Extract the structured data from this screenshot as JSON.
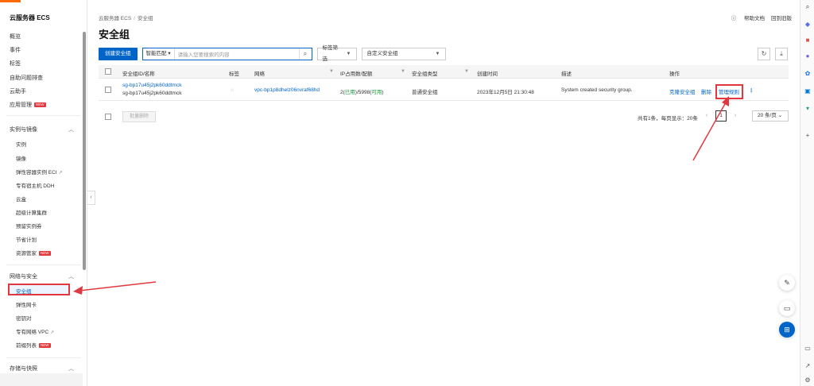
{
  "sidebar": {
    "brand": "云服务器 ECS",
    "top_items": [
      "概览",
      "事件",
      "标签",
      "自助问题排查",
      "云助手",
      "应用管理"
    ],
    "new_badge": "NEW",
    "group1": {
      "title": "实例与镜像",
      "items": [
        "实例",
        "镜像",
        "弹性容器实例 ECI",
        "专有宿主机 DDH",
        "云盒",
        "超级计算集群",
        "预留实例券",
        "节省计划",
        "资源管家"
      ]
    },
    "group2": {
      "title": "网络与安全",
      "items": [
        "安全组",
        "弹性网卡",
        "密钥对",
        "专有网络 VPC",
        "前缀列表"
      ]
    },
    "group3": {
      "title": "存储与快照"
    },
    "collapse_icon": "chevron-left-icon"
  },
  "header": {
    "breadcrumb": [
      "云服务器 ECS",
      "安全组"
    ],
    "help_doc": "帮助文档",
    "back_old": "回到旧版",
    "title": "安全组"
  },
  "toolbar": {
    "create_label": "创建安全组",
    "search_prefix": "智能匹配",
    "search_placeholder": "请输入您要搜索的内容",
    "tag_filter": "标签筛选",
    "custom_tag": "自定义安全组"
  },
  "table": {
    "columns": [
      "安全组ID/名称",
      "标签",
      "网络",
      "IP占用数/配额",
      "安全组类型",
      "创建时间",
      "描述",
      "操作"
    ],
    "rows": [
      {
        "id": "sg-bp17u45j2pk60ddtmck",
        "name": "sg-bp17u45j2pk60ddtmck",
        "network": "vpc-bp1p8dhelz06nvraf68hd",
        "ip_prefix": "2(",
        "ip_used": "已用",
        "ip_mid": ")/5998(",
        "ip_avail": "可用",
        "ip_suffix": ")",
        "type": "普通安全组",
        "created": "2023年12月5日 21:30:48",
        "desc": "System created security group.",
        "actions": [
          "克隆安全组",
          "删除",
          "管理规则"
        ]
      }
    ]
  },
  "footer": {
    "batch_delete": "批量删除",
    "summary": "共有1条，每页显示：20条",
    "current_page": "1",
    "per_page": "20 条/页"
  },
  "colors": {
    "primary": "#0064c8",
    "highlight": "#e0383e",
    "brand": "#ff6a00"
  }
}
